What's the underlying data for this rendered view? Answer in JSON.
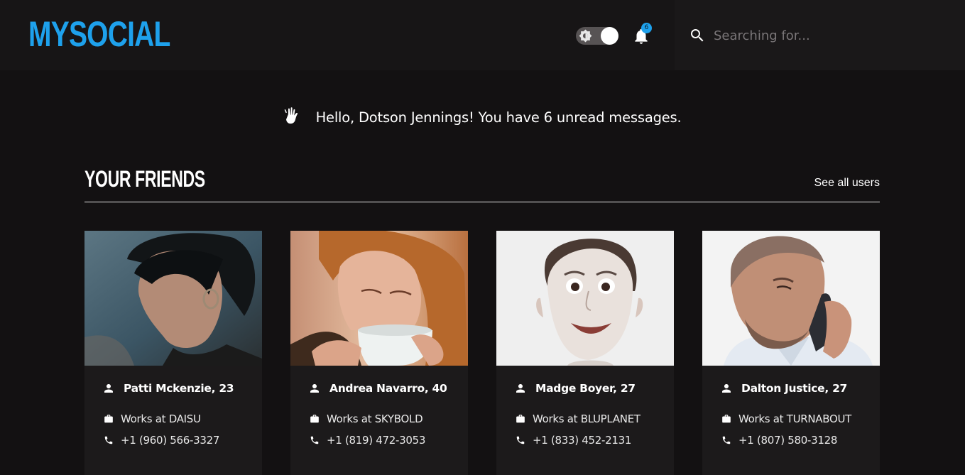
{
  "header": {
    "logo": "MYSOCIAL",
    "notifications_count": "6",
    "search": {
      "placeholder": "Searching for...",
      "value": ""
    }
  },
  "greeting": {
    "text": "Hello, Dotson Jennings! You have 6 unread messages."
  },
  "friends": {
    "title": "YOUR FRIENDS",
    "see_all_label": "See all users",
    "items": [
      {
        "name": "Patti Mckenzie, 23",
        "work": "Works at DAISU",
        "phone": "+1 (960) 566-3327"
      },
      {
        "name": "Andrea Navarro, 40",
        "work": "Works at SKYBOLD",
        "phone": "+1 (819) 472-3053"
      },
      {
        "name": "Madge Boyer, 27",
        "work": "Works at BLUPLANET",
        "phone": "+1 (833) 452-2131"
      },
      {
        "name": "Dalton Justice, 27",
        "work": "Works at TURNABOUT",
        "phone": "+1 (807) 580-3128"
      }
    ]
  },
  "colors": {
    "accent": "#1ea1ec",
    "background": "#131112",
    "card": "#1c1a1b"
  },
  "icons": [
    "sun-icon",
    "bell-icon",
    "search-icon",
    "wave-hand-icon",
    "person-icon",
    "briefcase-icon",
    "phone-icon"
  ]
}
